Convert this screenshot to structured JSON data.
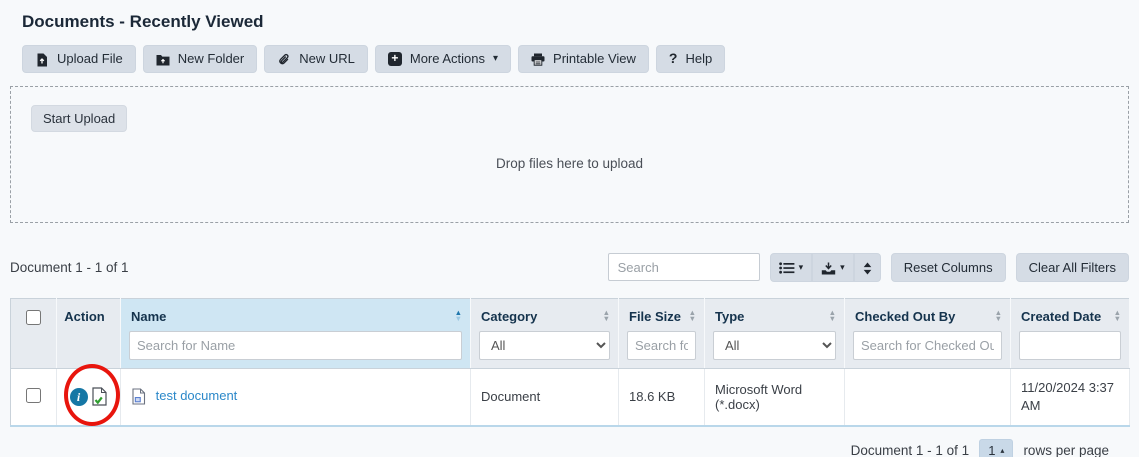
{
  "page_title": "Documents - Recently Viewed",
  "toolbar": {
    "buttons": [
      {
        "label": "Upload File",
        "icon": "upload-file-icon"
      },
      {
        "label": "New Folder",
        "icon": "new-folder-icon"
      },
      {
        "label": "New URL",
        "icon": "paperclip-icon"
      },
      {
        "label": "More Actions",
        "icon": "plus-square-icon",
        "has_caret": true
      },
      {
        "label": "Printable View",
        "icon": "printer-icon"
      },
      {
        "label": "Help",
        "icon": "question-icon"
      }
    ]
  },
  "upload_zone": {
    "start_button": "Start Upload",
    "drop_text": "Drop files here to upload"
  },
  "list_info": {
    "count_label": "Document 1 - 1 of 1"
  },
  "table_controls": {
    "search_placeholder": "Search",
    "icon_buttons": [
      "column-list-icon",
      "export-icon",
      "expand-rows-icon"
    ],
    "reset_columns_label": "Reset Columns",
    "clear_filters_label": "Clear All Filters"
  },
  "table": {
    "columns": [
      {
        "label": "Action"
      },
      {
        "label": "Name",
        "filter_placeholder": "Search for Name",
        "sorted": "ascending"
      },
      {
        "label": "Category",
        "filter_value": "All"
      },
      {
        "label": "File Size",
        "filter_placeholder": "Search fo"
      },
      {
        "label": "Type",
        "filter_value": "All"
      },
      {
        "label": "Checked Out By",
        "filter_placeholder": "Search for Checked Ou"
      },
      {
        "label": "Created Date",
        "filter_placeholder": ""
      }
    ],
    "rows": [
      {
        "name": "test document",
        "category": "Document",
        "file_size": "18.6 KB",
        "type": "Microsoft Word (*.docx)",
        "checked_out_by": "",
        "created_date": "11/20/2024 3:37 AM",
        "action_icons": [
          "info-icon",
          "document-checked-in-icon"
        ],
        "annotation": "red-circle-highlight-on-info-icon"
      }
    ]
  },
  "footer": {
    "count_label": "Document 1 - 1 of 1",
    "page_number": "1",
    "rows_per_page_label": "rows per page"
  },
  "icons": {
    "caret_down": "▾",
    "caret_up": "▴",
    "sort_up": "▲",
    "sort_down": "▼",
    "plus": "+",
    "question": "?",
    "info": "i"
  },
  "colors": {
    "page_bg": "#f7f9fb",
    "button_bg": "#d5dce5",
    "sorted_header_bg": "#cfe6f3",
    "header_bg": "#e7ebf0",
    "link_blue": "#2b88c9",
    "info_icon_bg": "#1577a5",
    "annotation_red": "#e8150d",
    "check_green": "#2f9e2f",
    "title_text": "#1b2837"
  }
}
